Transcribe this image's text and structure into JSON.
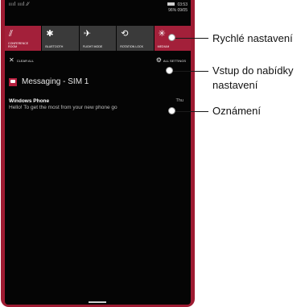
{
  "status": {
    "signal": "ıııl ıııl ⁄⁄",
    "time": "03:53",
    "battery_date": "96%  09/05"
  },
  "quick_settings": [
    {
      "label": "Conference room",
      "icon": "wifi-icon",
      "glyph": "⫽",
      "active": true
    },
    {
      "label": "Bluetooth",
      "icon": "bluetooth-icon",
      "glyph": "✱",
      "active": false
    },
    {
      "label": "Flight mode",
      "icon": "airplane-icon",
      "glyph": "✈",
      "active": false
    },
    {
      "label": "Rotation lock",
      "icon": "rotation-lock-icon",
      "glyph": "⟲",
      "active": false
    },
    {
      "label": "Medium",
      "icon": "brightness-icon",
      "glyph": "✳",
      "active": true
    }
  ],
  "actions": {
    "clear_all": "Clear all",
    "all_settings": "All settings"
  },
  "group": {
    "app_name": "Messaging - SIM 1"
  },
  "notification": {
    "title": "Windows Phone",
    "time": "Thu",
    "body": "Hello! To get the most from your new phone go"
  },
  "callouts": {
    "quick_settings": "Rychlé nastavení",
    "settings_line1": "Vstup do nabídky",
    "settings_line2": "nastavení",
    "notifications": "Oznámení"
  },
  "colors": {
    "accent": "#a3203a",
    "phone_frame": "#9e1b32",
    "screen": "#050505"
  }
}
